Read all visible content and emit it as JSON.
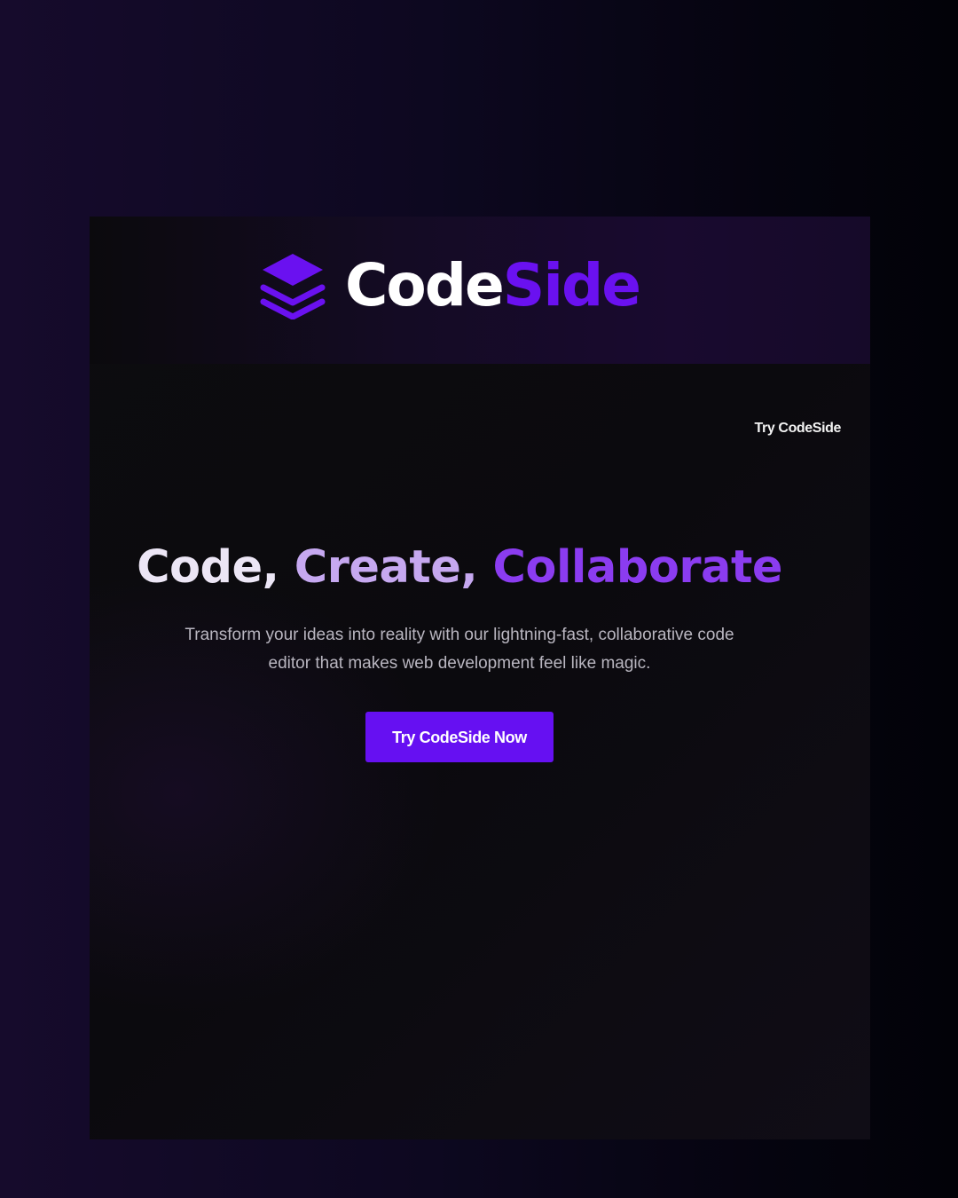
{
  "brand": {
    "name_part1": "Code",
    "name_part2": "Side",
    "logo_icon": "layers-icon",
    "accent_color": "#6a11f0"
  },
  "nav": {
    "try_link": "Try CodeSide"
  },
  "hero": {
    "headline_part1": "Code,",
    "headline_part2": "Create,",
    "headline_part3": "Collaborate",
    "subtitle": "Transform your ideas into reality with our lightning-fast, collaborative code editor that makes web development feel like magic.",
    "cta_label": "Try CodeSide Now"
  },
  "colors": {
    "background": "#0b0a0e",
    "primary": "#6610f2",
    "headline_light": "#ece6f5",
    "headline_mid": "#c6a8f0",
    "headline_strong": "#8b3cf0"
  }
}
